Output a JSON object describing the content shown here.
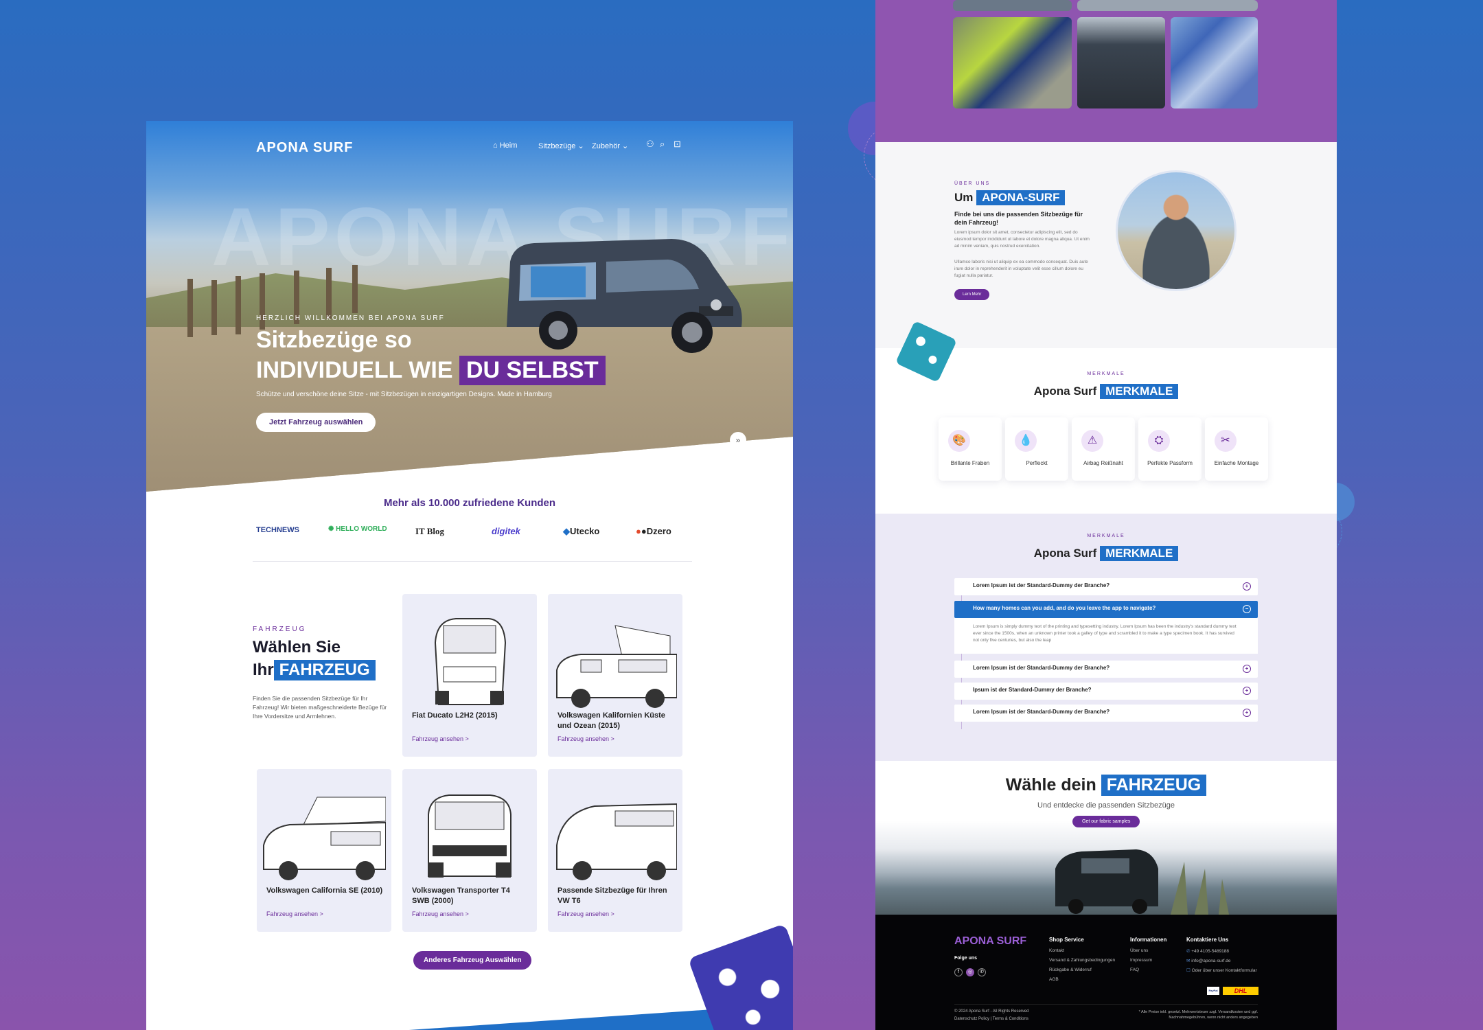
{
  "left": {
    "nav": {
      "logo": "APONA SURF",
      "links": [
        "Heim",
        "Sitzbezüge",
        "Zubehör"
      ]
    },
    "hero": {
      "watermark": "APONA SURF",
      "welcome": "HERZLICH WILLKOMMEN BEI APONA SURF",
      "title_line1": "Sitzbezüge so",
      "title_line2_a": "INDIVIDUELL WIE",
      "title_line2_b": "DU SELBST",
      "subtitle": "Schütze und verschöne deine Sitze - mit Sitzbezügen in einzigartigen Designs. Made in Hamburg",
      "button": "Jetzt Fahrzeug auswählen"
    },
    "customers": "Mehr als 10.000 zufriedene Kunden",
    "brands": [
      "TECHNEWS",
      "HELLO WORLD",
      "IT Blog",
      "digitek",
      "Utecko",
      "Dzero"
    ],
    "vehicles": {
      "eyebrow": "FAHRZEUG",
      "title_a": "Wählen Sie",
      "title_b": "Ihr",
      "title_hl": "FAHRZEUG",
      "description": "Finden Sie die passenden Sitzbezüge für Ihr Fahrzeug! Wir bieten maßgeschneiderte Bezüge für Ihre Vordersitze und Armlehnen.",
      "link": "Fahrzeug ansehen >",
      "cards": [
        {
          "name": "Fiat Ducato L2H2 (2015)"
        },
        {
          "name": "Volkswagen Kalifornien Küste und Ozean (2015)"
        },
        {
          "name": "Volkswagen California SE (2010)"
        },
        {
          "name": "Volkswagen Transporter T4 SWB (2000)"
        },
        {
          "name": "Passende Sitzbezüge für Ihren VW T6"
        }
      ],
      "other_button": "Anderes Fahrzeug Auswählen"
    }
  },
  "right": {
    "about": {
      "eyebrow": "ÜBER UNS",
      "title_a": "Um",
      "title_hl": "APONA-SURF",
      "subtitle": "Finde bei uns die passenden Sitzbezüge für dein Fahrzeug!",
      "p1": "Lorem ipsum dolor sit amet, consectetur adipiscing elit, sed do eiusmod tempor incididunt ut labore et dolore magna aliqua. Ut enim ad minim veniam, quis nostrud exercitation.",
      "p2": "Ullamco laboris nisi ut aliquip ex ea commodo consequat. Duis aute irure dolor in reprehenderit in voluptate velit esse cillum dolore eu fugiat nulla pariatur.",
      "button": "Lern Mehr"
    },
    "features": {
      "eyebrow": "MERKMALE",
      "title_a": "Apona Surf",
      "title_hl": "MERKMALE",
      "items": [
        {
          "label": "Brillante Fraben",
          "icon": "palette-icon"
        },
        {
          "label": "Perfleckt",
          "icon": "drop-icon"
        },
        {
          "label": "Airbag Reißnaht",
          "icon": "airbag-icon"
        },
        {
          "label": "Perfekte Passform",
          "icon": "seat-icon"
        },
        {
          "label": "Einfache Montage",
          "icon": "tools-icon"
        }
      ]
    },
    "faq": {
      "eyebrow": "MERKMALE",
      "title_a": "Apona Surf",
      "title_hl": "MERKMALE",
      "items": [
        "Lorem Ipsum ist der Standard-Dummy der Branche?",
        "How many homes can you add, and do you leave the app to navigate?",
        "Lorem Ipsum ist der Standard-Dummy der Branche?",
        "Ipsum ist der Standard-Dummy der Branche?",
        "Lorem Ipsum ist der Standard-Dummy der Branche?"
      ],
      "open_body": "Lorem Ipsum is simply dummy text of the printing and typesetting industry. Lorem Ipsum has been the industry's standard dummy text ever since the 1500s, when an unknown printer took a galley of type and scrambled it to make a type specimen book. It has survived not only five centuries, but also the leap"
    },
    "choose": {
      "title_a": "Wähle dein",
      "title_hl": "FAHRZEUG",
      "subtitle": "Und entdecke die passenden Sitzbezüge",
      "button": "Get our fabric samples"
    },
    "footer": {
      "logo": "APONA SURF",
      "follow": "Folge uns",
      "col1_title": "Shop Service",
      "col1": [
        "Kontakt",
        "Versand & Zahlungsbedingungen",
        "Rückgabe & Widerruf",
        "AGB"
      ],
      "col2_title": "Informationen",
      "col2": [
        "Über uns",
        "Impressum",
        "FAQ"
      ],
      "col3_title": "Kontaktiere Uns",
      "col3": [
        "+49 4105-5489188",
        "info@apona-surf.de",
        "Oder über unser Kontaktformular"
      ],
      "copyright": "© 2024 Apona Surf - All Rights Reserved",
      "legal": "Datenschutz Policy  |  Terms & Conditions",
      "price_note": "* Alle Preise inkl. gesetzl. Mehrwertsteuer zzgl. Versandkosten und ggf. Nachnahmegebühren, wenn nicht anders angegeben",
      "payment": [
        "PayPal",
        "DHL"
      ]
    }
  },
  "colors": {
    "purple": "#6a2c9a",
    "blue": "#1f6fc7",
    "bg_top": "#2a6cc0",
    "bg_bottom": "#8a54ac"
  }
}
